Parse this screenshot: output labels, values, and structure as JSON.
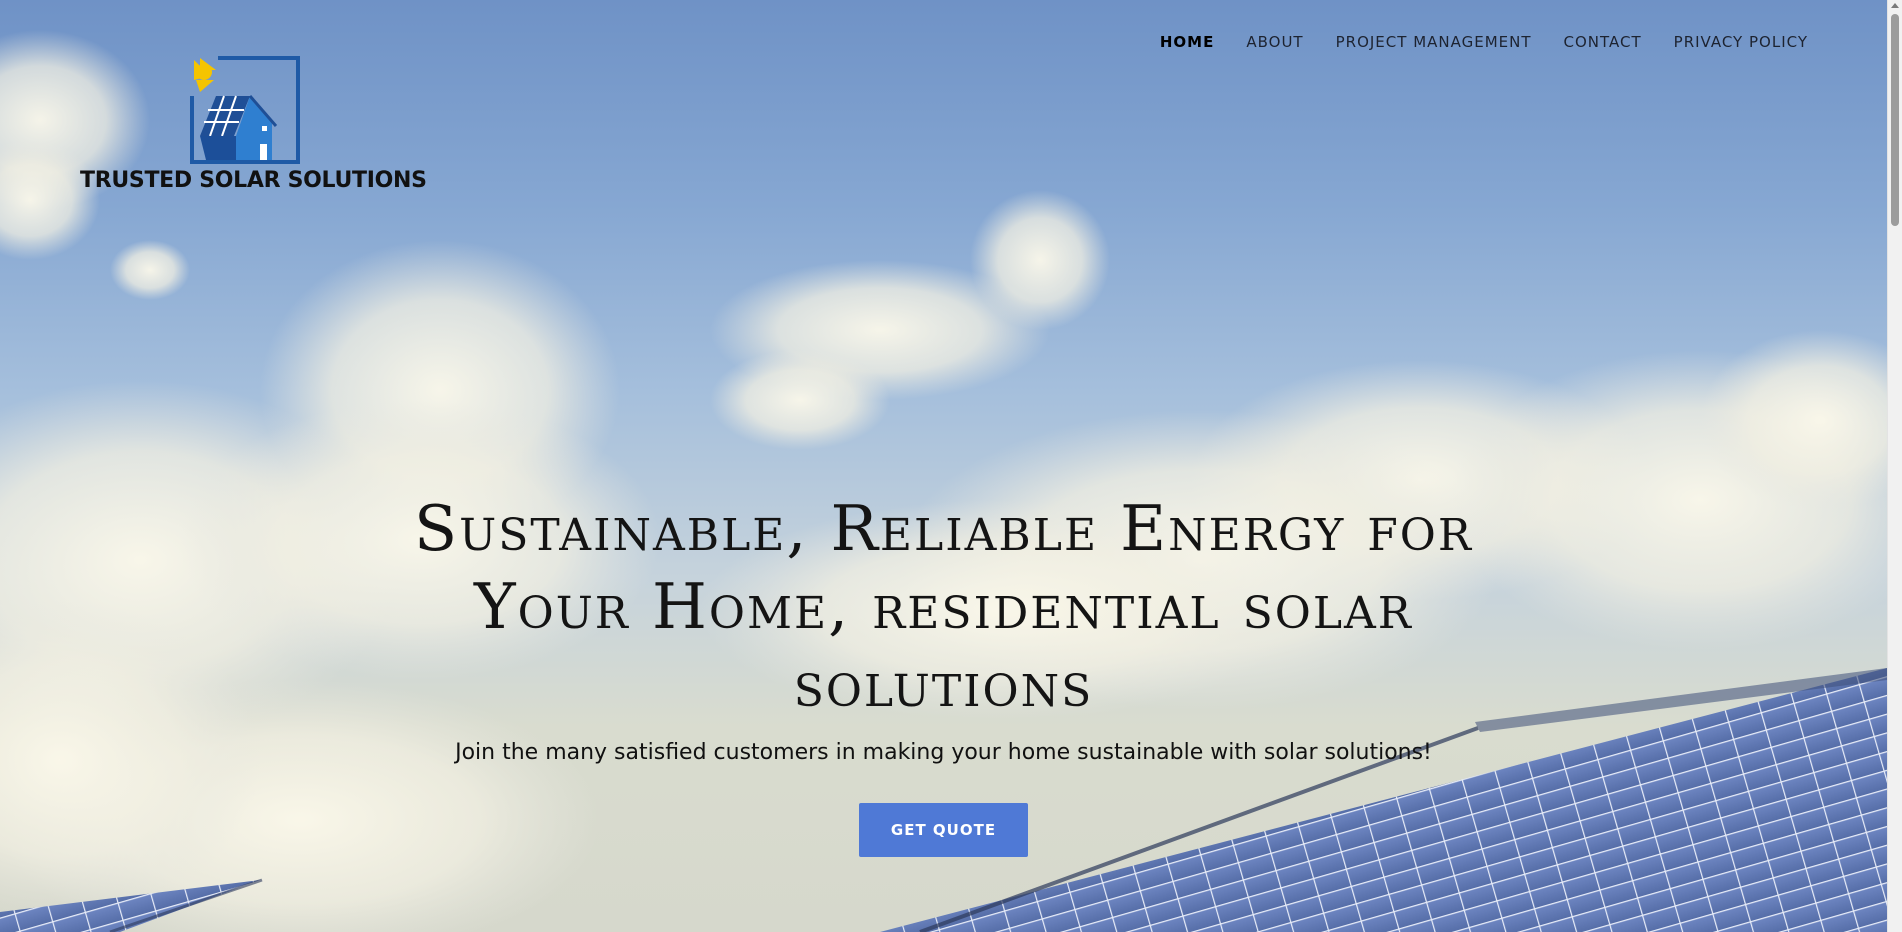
{
  "brand": {
    "name": "TRUSTED SOLAR SOLUTIONS",
    "logo_icon": "house-solar-panel-sun-icon",
    "colors": {
      "frame": "#1f5aa6",
      "panel": "#1f4f96",
      "house": "#2f7fd0",
      "sun": "#f5c400"
    }
  },
  "nav": {
    "items": [
      {
        "label": "HOME",
        "active": true
      },
      {
        "label": "ABOUT",
        "active": false
      },
      {
        "label": "PROJECT MANAGEMENT",
        "active": false
      },
      {
        "label": "CONTACT",
        "active": false
      },
      {
        "label": "PRIVACY POLICY",
        "active": false
      }
    ]
  },
  "hero": {
    "title": "Sustainable, Reliable Energy for Your Home, residential solar solutions",
    "subtitle": "Join the many satisfied customers in making your home sustainable with solar solutions!",
    "cta_label": "GET QUOTE",
    "background": "sky-clouds-solar-panels-photo"
  },
  "colors": {
    "cta": "#4f79d6",
    "nav_text": "#1d2330"
  }
}
